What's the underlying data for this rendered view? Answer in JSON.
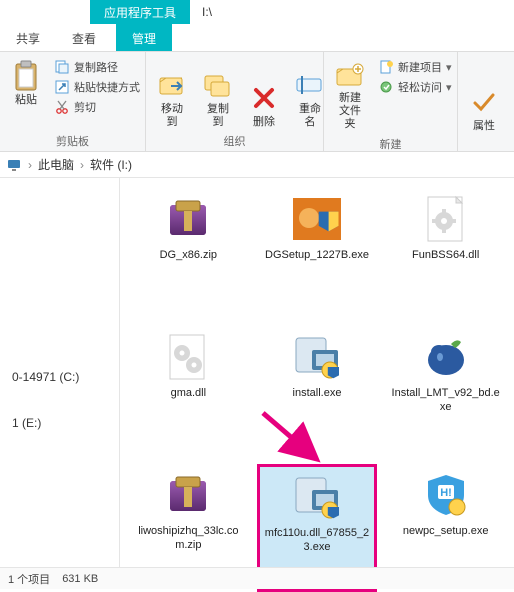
{
  "title": {
    "tools_tab": "应用程序工具",
    "path": "I:\\"
  },
  "tabs": {
    "share": "共享",
    "view": "查看",
    "manage": "管理"
  },
  "ribbon": {
    "clipboard": {
      "copy_path": "复制路径",
      "paste_shortcut": "粘贴快捷方式",
      "paste": "粘贴",
      "cut": "剪切",
      "group": "剪贴板"
    },
    "organize": {
      "move_to": "移动到",
      "copy_to": "复制到",
      "delete": "删除",
      "rename": "重命名",
      "group": "组织"
    },
    "new": {
      "new_folder": "新建\n文件夹",
      "new_item": "新建项目",
      "easy_access": "轻松访问",
      "group": "新建"
    },
    "props": {
      "properties": "属性"
    }
  },
  "crumb": {
    "pc": "此电脑",
    "drive": "软件 (I:)"
  },
  "nav": {
    "drive_c": "0-14971 (C:)",
    "drive_e": "1 (E:)"
  },
  "files": [
    {
      "name": "DG_x86.zip",
      "type": "zip"
    },
    {
      "name": "DGSetup_1227B.exe",
      "type": "setup-shield"
    },
    {
      "name": "FunBSS64.dll",
      "type": "dll"
    },
    {
      "name": "gma.dll",
      "type": "dll-gear"
    },
    {
      "name": "install.exe",
      "type": "installer"
    },
    {
      "name": "Install_LMT_v92_bd.exe",
      "type": "blob"
    },
    {
      "name": "liwoshipizhq_33lc.com.zip",
      "type": "zip"
    },
    {
      "name": "mfc110u.dll_67855_23.exe",
      "type": "installer",
      "selected": true
    },
    {
      "name": "newpc_setup.exe",
      "type": "shield-h"
    }
  ],
  "status": {
    "selected": "1 个项目",
    "size": "631 KB"
  }
}
